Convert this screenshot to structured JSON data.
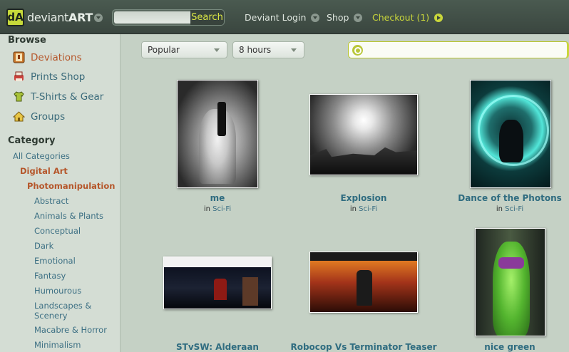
{
  "header": {
    "logo_mark": "dA",
    "logo_text_light": "deviant",
    "logo_text_bold": "ART",
    "search_placeholder": "",
    "search_button": "Search",
    "login_label": "Deviant Login",
    "shop_label": "Shop",
    "checkout_label": "Checkout (1)"
  },
  "sidebar": {
    "browse_heading": "Browse",
    "browse_items": [
      {
        "label": "Deviations",
        "icon": "deviations-icon",
        "active": true
      },
      {
        "label": "Prints Shop",
        "icon": "prints-icon",
        "active": false
      },
      {
        "label": "T-Shirts & Gear",
        "icon": "tshirt-icon",
        "active": false
      },
      {
        "label": "Groups",
        "icon": "groups-icon",
        "active": false
      }
    ],
    "category_heading": "Category",
    "categories": [
      {
        "label": "All Categories",
        "level": 0
      },
      {
        "label": "Digital Art",
        "level": 1
      },
      {
        "label": "Photomanipulation",
        "level": 2
      },
      {
        "label": "Abstract",
        "level": 3
      },
      {
        "label": "Animals & Plants",
        "level": 3
      },
      {
        "label": "Conceptual",
        "level": 3
      },
      {
        "label": "Dark",
        "level": 3
      },
      {
        "label": "Emotional",
        "level": 3
      },
      {
        "label": "Fantasy",
        "level": 3
      },
      {
        "label": "Humourous",
        "level": 3
      },
      {
        "label": "Landscapes &\nScenery",
        "level": 3
      },
      {
        "label": "Macabre & Horror",
        "level": 3
      },
      {
        "label": "Minimalism",
        "level": 3
      }
    ]
  },
  "filters": {
    "sort_value": "Popular",
    "time_value": "8 hours",
    "search_value": ""
  },
  "gallery": [
    {
      "title": "me",
      "in_label": "in",
      "category": "Sci-Fi"
    },
    {
      "title": "Explosion",
      "in_label": "in",
      "category": "Sci-Fi"
    },
    {
      "title": "Dance of the Photons",
      "in_label": "in",
      "category": "Sci-Fi"
    },
    {
      "title": "STvSW: Alderaan",
      "in_label": "",
      "category": ""
    },
    {
      "title": "Robocop Vs Terminator Teaser",
      "in_label": "",
      "category": ""
    },
    {
      "title": "nice green",
      "in_label": "",
      "category": ""
    }
  ],
  "colors": {
    "topbar": "#3a463f",
    "accent_green": "#c9d63b",
    "link_blue": "#3d7084",
    "active_orange": "#b5562a",
    "sidebar_bg": "#d4ddd4",
    "content_bg": "#c5d1c5"
  }
}
